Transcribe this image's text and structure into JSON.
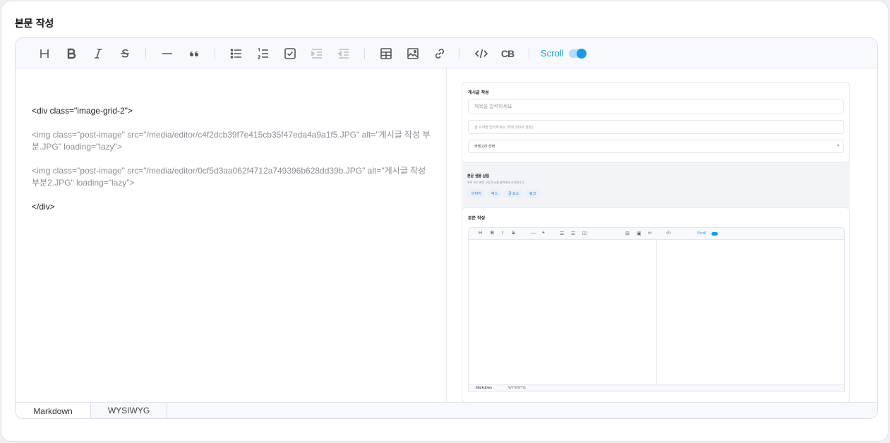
{
  "section": {
    "title": "본문 작성"
  },
  "toolbar": {
    "buttons": [
      "heading",
      "bold",
      "italic",
      "strike",
      "hr",
      "quote",
      "bullet-list",
      "ordered-list",
      "task-list",
      "indent",
      "outdent",
      "table",
      "image",
      "link",
      "code",
      "codeblock"
    ],
    "codeblock_label": "CB",
    "scroll_label": "Scroll",
    "scroll_enabled": true
  },
  "markdown": {
    "lines": [
      "<div class=\"image-grid-2\">",
      "<img class=\"post-image\" src=\"/media/editor/c4f2dcb39f7e415cb35f47eda4a9a1f5.JPG\" alt=\"게시글 작성 부분.JPG\" loading=\"lazy\">",
      "<img class=\"post-image\" src=\"/media/editor/0cf5d3aa062f4712a749396b628dd39b.JPG\" alt=\"게시글 작성 부분2.JPG\" loading=\"lazy\">",
      "</div>"
    ]
  },
  "preview_image": {
    "header_title": "게시글 작성",
    "title_placeholder": "제목을 입력하세요",
    "summary_placeholder": "글 요약을 입력하세요 (최대 200자 권장)",
    "category_placeholder": "카테고리 선택",
    "sample_title": "본문 샘플 삽입",
    "sample_desc": "자주 쓰는 본문 구성 요소를 클릭해서 추가합니다.",
    "chips": [
      "이미지",
      "박스",
      "글 요소",
      "링크"
    ],
    "editor_title": "본문 작성",
    "mini_scroll": "Scroll",
    "mini_tab_markdown": "Markdown",
    "mini_tab_wysiwyg": "WYSIWYG"
  },
  "tabs": {
    "markdown": "Markdown",
    "wysiwyg": "WYSIWYG",
    "active": "markdown"
  },
  "colors": {
    "accent": "#1a9be8",
    "toolbar_bg": "#f7f9fc",
    "border": "#dadde6"
  }
}
